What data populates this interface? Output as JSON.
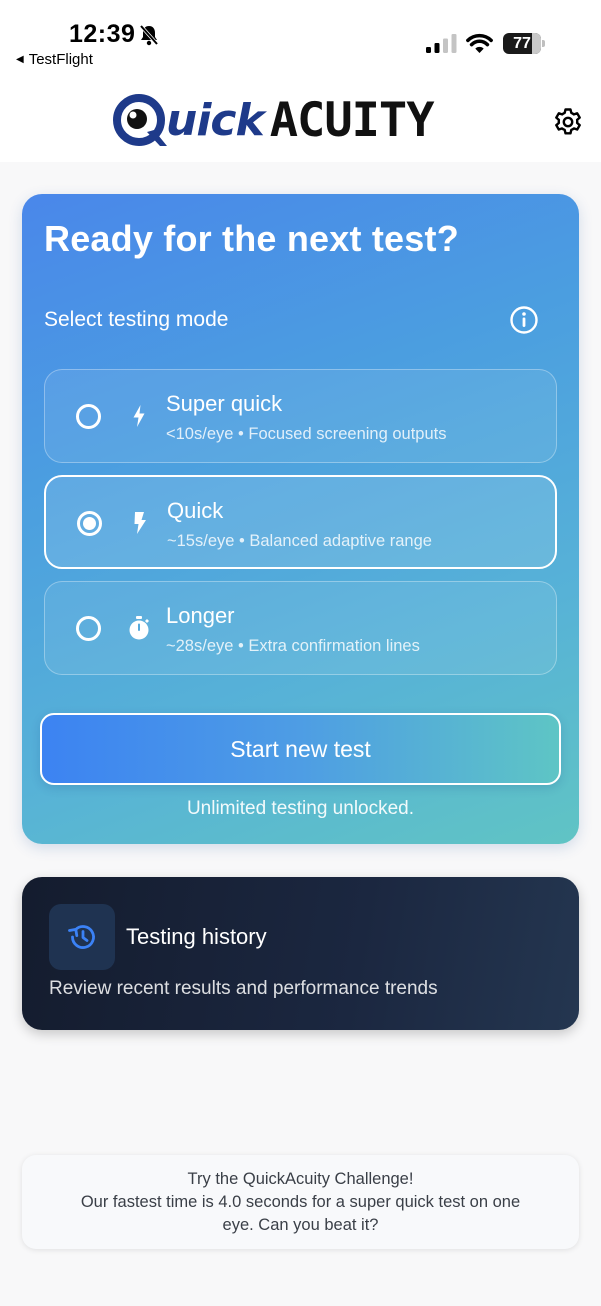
{
  "status_bar": {
    "time": "12:39",
    "back_label": "TestFlight",
    "battery_level": "77",
    "battery_fraction": 0.77
  },
  "header": {
    "logo_part1": "uick",
    "logo_part2": "ACUITY",
    "logo_brand_color": "#1e3a8a"
  },
  "mode_card": {
    "title": "Ready for the next test?",
    "mode_label": "Select testing mode",
    "options": [
      {
        "title": "Super quick",
        "subtitle": "<10s/eye • Focused screening outputs",
        "icon": "lightning-bolt-icon",
        "selected": false
      },
      {
        "title": "Quick",
        "subtitle": "~15s/eye • Balanced adaptive range",
        "icon": "flash-bolt-icon",
        "selected": true
      },
      {
        "title": "Longer",
        "subtitle": "~28s/eye • Extra confirmation lines",
        "icon": "stopwatch-icon",
        "selected": false
      }
    ],
    "start_button_label": "Start new test",
    "unlock_note": "Unlimited testing unlocked."
  },
  "history_card": {
    "title": "Testing history",
    "description": "Review recent results and performance trends",
    "icon": "history-icon"
  },
  "challenge": {
    "line1": "Try the QuickAcuity Challenge!",
    "line2": "Our fastest time is 4.0 seconds for a super quick test on one",
    "line3": "eye. Can you beat it?"
  },
  "colors": {
    "card_gradient_start": "#4a87ea",
    "card_gradient_end": "#60c4c4",
    "history_bg": "#141c2e",
    "page_bg": "#f8f8f9"
  }
}
